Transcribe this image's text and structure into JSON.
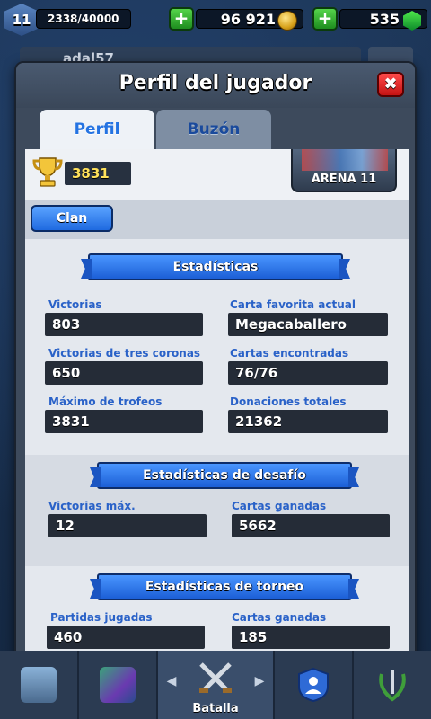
{
  "hud": {
    "level": "11",
    "xp": "2338/40000",
    "gold": "96 921",
    "gems": "535",
    "player_name_behind": "adal57"
  },
  "modal": {
    "title": "Perfil del jugador",
    "close_label": "✖",
    "tabs": [
      {
        "label": "Perfil",
        "active": true
      },
      {
        "label": "Buzón",
        "active": false
      }
    ],
    "trophies": "3831",
    "arena": "ARENA 11",
    "clan_button": "Clan",
    "stats": {
      "title": "Estadísticas",
      "left": [
        {
          "label": "Victorias",
          "value": "803"
        },
        {
          "label": "Victorias de tres coronas",
          "value": "650"
        },
        {
          "label": "Máximo de trofeos",
          "value": "3831"
        }
      ],
      "right": [
        {
          "label": "Carta favorita actual",
          "value": "Megacaballero"
        },
        {
          "label": "Cartas encontradas",
          "value": "76/76"
        },
        {
          "label": "Donaciones totales",
          "value": "21362"
        }
      ]
    },
    "challenge": {
      "title": "Estadísticas de desafío",
      "left": {
        "label": "Victorias máx.",
        "value": "12"
      },
      "right": {
        "label": "Cartas ganadas",
        "value": "5662"
      }
    },
    "tournament": {
      "title": "Estadísticas de torneo",
      "left": {
        "label": "Partidas jugadas",
        "value": "460"
      },
      "right": {
        "label": "Cartas ganadas",
        "value": "185"
      }
    }
  },
  "nav": {
    "battle_label": "Batalla",
    "left_arrow": "◀",
    "right_arrow": "▶"
  },
  "colors": {
    "accent_blue": "#2473e2",
    "trophy_gold": "#ffe15a",
    "close_red": "#e02020",
    "plus_green": "#2fb12c"
  }
}
